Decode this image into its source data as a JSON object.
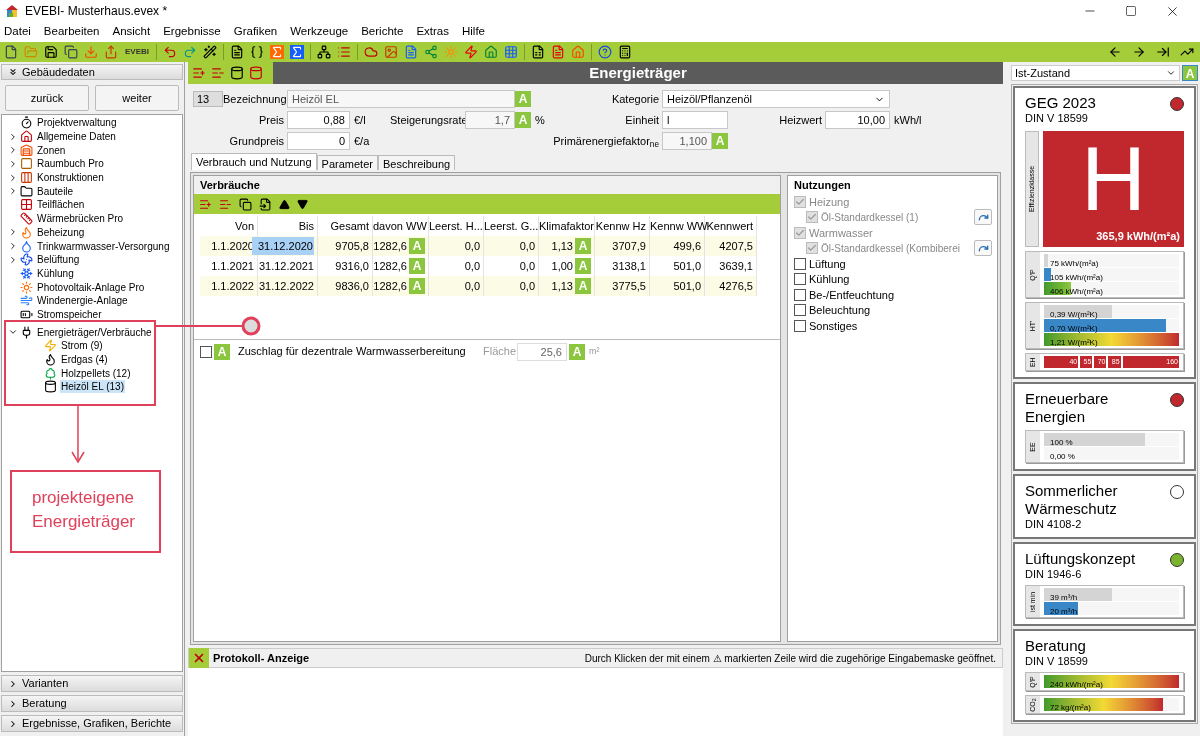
{
  "window": {
    "title": "EVEBI- Musterhaus.evex *"
  },
  "menu": [
    "Datei",
    "Bearbeiten",
    "Ansicht",
    "Ergebnisse",
    "Grafiken",
    "Werkzeuge",
    "Berichte",
    "Extras",
    "Hilfe"
  ],
  "toolbar": {
    "label": "EVEBI"
  },
  "sidebar": {
    "header": {
      "label": "Gebäudedaten",
      "expanded": true
    },
    "buttons": [
      "zurück",
      "weiter"
    ],
    "tree": [
      {
        "label": "Projektverwaltung",
        "kind": "leaf",
        "selected": false
      },
      {
        "label": "Allgemeine Daten",
        "kind": "folder",
        "expanded": false,
        "selected": false
      },
      {
        "label": "Zonen",
        "kind": "folder",
        "expanded": false,
        "selected": false
      },
      {
        "label": "Raumbuch Pro",
        "kind": "folder",
        "expanded": false,
        "selected": false
      },
      {
        "label": "Konstruktionen",
        "kind": "folder",
        "expanded": false,
        "selected": false
      },
      {
        "label": "Bauteile",
        "kind": "folder",
        "expanded": false,
        "selected": false
      },
      {
        "label": "Teilflächen",
        "kind": "leaf",
        "selected": false
      },
      {
        "label": "Wärmebrücken Pro",
        "kind": "leaf",
        "selected": false
      },
      {
        "label": "Beheizung",
        "kind": "folder",
        "expanded": false,
        "selected": false
      },
      {
        "label": "Trinkwarmwasser-Versorgung",
        "kind": "folder",
        "expanded": false,
        "selected": false
      },
      {
        "label": "Belüftung",
        "kind": "folder",
        "expanded": false,
        "selected": false
      },
      {
        "label": "Kühlung",
        "kind": "leaf",
        "selected": false
      },
      {
        "label": "Photovoltaik-Anlage Pro",
        "kind": "leaf",
        "selected": false
      },
      {
        "label": "Windenergie-Anlage",
        "kind": "leaf",
        "selected": false
      },
      {
        "label": "Stromspeicher",
        "kind": "leaf",
        "selected": false
      },
      {
        "label": "Energieträger/Verbräuche",
        "kind": "folder",
        "expanded": true,
        "selected": false,
        "children": [
          {
            "label": "Strom (9)",
            "selected": false
          },
          {
            "label": "Erdgas (4)",
            "selected": false
          },
          {
            "label": "Holzpellets (12)",
            "selected": false
          },
          {
            "label": "Heizöl EL (13)",
            "selected": true
          }
        ]
      }
    ],
    "sections": [
      {
        "label": "Varianten",
        "expanded": false
      },
      {
        "label": "Beratung",
        "expanded": false
      },
      {
        "label": "Ergebnisse, Grafiken, Berichte",
        "expanded": false
      }
    ]
  },
  "annotation": {
    "callout": "projekteigene Energieträger"
  },
  "main": {
    "title": "Energieträger",
    "form": {
      "number": "13",
      "name": {
        "label": "Bezeichnung",
        "value": "Heizöl EL",
        "badge": "A",
        "disabled": true
      },
      "category": {
        "label": "Kategorie",
        "value": "Heizöl/Pflanzenöl"
      },
      "price": {
        "label": "Preis",
        "value": "0,88",
        "unit": "€/l",
        "disabled": false
      },
      "growth": {
        "label": "Steigerungsrate",
        "value": "1,7",
        "badge": "A",
        "unit": "%",
        "disabled": true
      },
      "unit": {
        "label": "Einheit",
        "value": "l",
        "disabled": false
      },
      "heating_value": {
        "label": "Heizwert",
        "value": "10,00",
        "unit": "kWh/l",
        "disabled": false
      },
      "base_price": {
        "label": "Grundpreis",
        "value": "0",
        "unit": "€/a",
        "disabled": false
      },
      "primary_factor": {
        "label": "Primärenergiefaktor$_{ne}$",
        "value": "1,100",
        "badge": "A",
        "disabled": true
      }
    },
    "tabs": [
      {
        "label": "Verbrauch und Nutzung",
        "selected": true
      },
      {
        "label": "Parameter",
        "selected": false
      },
      {
        "label": "Beschreibung",
        "selected": false
      }
    ],
    "consumption": {
      "title": "Verbräuche",
      "columns": [
        "Von",
        "Bis",
        "Gesamt",
        "davon WW",
        "Leerst. H...",
        "Leerst. G...",
        "Klimafaktor",
        "Kennw Hz",
        "Kennw WW",
        "Kennwert"
      ],
      "rows": [
        {
          "cells": [
            "1.1.2020",
            "31.12.2020",
            "9705,8",
            "1282,6",
            "0,0",
            "0,0",
            "1,13",
            "3707,9",
            "499,6",
            "4207,5"
          ],
          "ww_badge": "A",
          "climate_badge": "A",
          "bis_selected": true
        },
        {
          "cells": [
            "1.1.2021",
            "31.12.2021",
            "9316,0",
            "1282,6",
            "0,0",
            "0,0",
            "1,00",
            "3138,1",
            "501,0",
            "3639,1"
          ],
          "ww_badge": "A",
          "climate_badge": "A",
          "bis_selected": false
        },
        {
          "cells": [
            "1.1.2022",
            "31.12.2022",
            "9836,0",
            "1282,6",
            "0,0",
            "0,0",
            "1,13",
            "3775,5",
            "501,0",
            "4276,5"
          ],
          "ww_badge": "A",
          "climate_badge": "A",
          "bis_selected": false
        }
      ]
    },
    "surcharge": {
      "checked": false,
      "badge": "A",
      "label": "Zuschlag für dezentrale Warmwasserbereitung",
      "area_label": "Fläche",
      "area_value": "25,6",
      "area_badge": "A",
      "area_unit": "m²"
    },
    "usages": {
      "title": "Nutzungen",
      "items": [
        {
          "label": "Heizung",
          "checked": true,
          "disabled": true,
          "children": [
            {
              "label": "Öl-Standardkessel (1)",
              "checked": true,
              "disabled": true
            }
          ]
        },
        {
          "label": "Warmwasser",
          "checked": true,
          "disabled": true,
          "children": [
            {
              "label": "Öl-Standardkessel (Kombiberei",
              "checked": true,
              "disabled": true
            }
          ]
        },
        {
          "label": "Lüftung",
          "checked": false,
          "disabled": false
        },
        {
          "label": "Kühlung",
          "checked": false,
          "disabled": false
        },
        {
          "label": "Be-/Entfeuchtung",
          "checked": false,
          "disabled": false
        },
        {
          "label": "Beleuchtung",
          "checked": false,
          "disabled": false
        },
        {
          "label": "Sonstiges",
          "checked": false,
          "disabled": false
        }
      ]
    },
    "log": {
      "title": "Protokoll- Anzeige",
      "hint": "Durch Klicken der mit einem ⚠ markierten Zeile wird die zugehörige Eingabemaske geöffnet."
    }
  },
  "results": {
    "scenario": "Ist-Zustand",
    "badge": "A",
    "cards": [
      {
        "title": "GEG 2023",
        "subtitle": "DIN V 18599",
        "color": "#c0282d",
        "rating": {
          "label": "Effizienzklasse",
          "class": "H",
          "value": "365,9 kWh/(m²a)"
        },
        "groups": [
          {
            "label": "Q'P",
            "bars": [
              {
                "text": "75 kWh/(m²a)",
                "level": 0.03,
                "kind": "grey"
              },
              {
                "text": "105 kWh/(m²a)",
                "level": 0.05,
                "kind": "blue"
              },
              {
                "text": "406 kWh/(m²a)",
                "level": 0.2,
                "kind": "green"
              }
            ]
          },
          {
            "label": "HT'",
            "bars": [
              {
                "text": "0,39 W/(m²K)",
                "level": 0.5,
                "kind": "grey"
              },
              {
                "text": "0,70 W/(m²K)",
                "level": 0.9,
                "kind": "blue"
              },
              {
                "text": "1,21 W/(m²K)",
                "level": 1,
                "kind": "gradient"
              }
            ]
          }
        ],
        "scale": {
          "label": "EH",
          "ticks": [
            "40",
            "55",
            "70",
            "85",
            "160"
          ]
        }
      },
      {
        "title": "Erneuerbare Energien",
        "color": "#c0282d",
        "groups": [
          {
            "label": "EE",
            "bars": [
              {
                "text": "100 %",
                "level": 0.75,
                "kind": "grey"
              },
              {
                "text": "0,00 %"
              }
            ]
          }
        ]
      },
      {
        "title": "Sommerlicher Wärmeschutz",
        "subtitle": "DIN 4108-2",
        "color": "#ffffff"
      },
      {
        "title": "Lüftungskonzept",
        "subtitle": "DIN 1946-6",
        "color": "#7ab32e",
        "groups": [
          {
            "label": "ist min",
            "bars": [
              {
                "text": "39 m³/h",
                "level": 0.5,
                "kind": "grey"
              },
              {
                "text": "20 m³/h",
                "level": 0.25,
                "kind": "blue"
              }
            ]
          }
        ]
      },
      {
        "title": "Beratung",
        "subtitle": "DIN V 18599",
        "groups": [
          {
            "label": "Q'P",
            "bars": [
              {
                "text": "240 kWh/(m²a)",
                "level": 1,
                "kind": "gradient"
              }
            ]
          },
          {
            "label": "CO$_{2}$",
            "bars": [
              {
                "text": "72 kg/(m²a)",
                "level": 0.88,
                "kind": "gradient"
              }
            ]
          }
        ]
      }
    ]
  }
}
